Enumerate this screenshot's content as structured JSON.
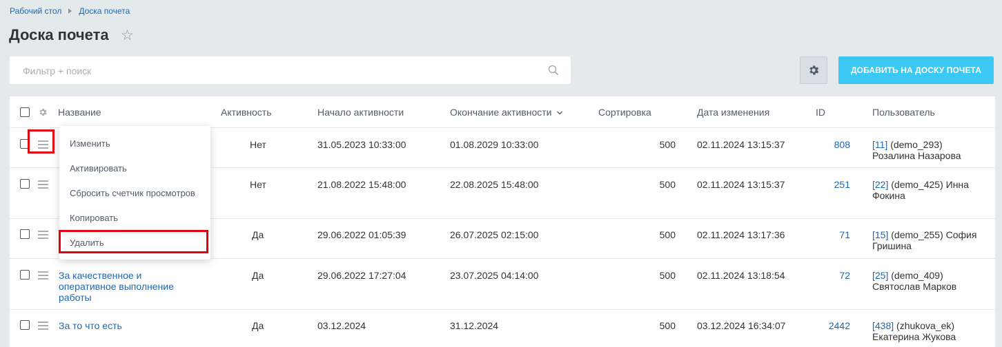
{
  "breadcrumb": [
    "Рабочий стол",
    "Доска почета"
  ],
  "page_title": "Доска почета",
  "filter": {
    "placeholder": "Фильтр + поиск"
  },
  "add_button": "ДОБАВИТЬ НА ДОСКУ ПОЧЕТА",
  "columns": {
    "name": "Название",
    "active": "Активность",
    "start": "Начало активности",
    "end": "Окончание активности",
    "sort": "Сортировка",
    "modified": "Дата изменения",
    "id": "ID",
    "user": "Пользователь"
  },
  "rows": [
    {
      "name": "",
      "active": "Нет",
      "start": "31.05.2023 10:33:00",
      "end": "01.08.2029 10:33:00",
      "sort": "500",
      "modified": "02.11.2024 13:15:37",
      "id": "808",
      "user_id": "[11]",
      "user_rest": " (demo_293)",
      "user_line2": "Розалина Назарова"
    },
    {
      "name": "",
      "active": "Нет",
      "start": "21.08.2022 15:48:00",
      "end": "22.08.2025 15:48:00",
      "sort": "500",
      "modified": "02.11.2024 13:15:37",
      "id": "251",
      "user_id": "[22]",
      "user_rest": " (demo_425) Инна",
      "user_line2": "Фокина"
    },
    {
      "name": "",
      "active": "Да",
      "start": "29.06.2022 01:05:39",
      "end": "26.07.2025 02:15:00",
      "sort": "500",
      "modified": "02.11.2024 13:17:36",
      "id": "71",
      "user_id": "[15]",
      "user_rest": " (demo_255) София",
      "user_line2": "Гришина"
    },
    {
      "name_lines": [
        "За качественное и",
        "оперативное выполнение",
        "работы"
      ],
      "active": "Да",
      "start": "29.06.2022 17:27:04",
      "end": "23.07.2025 04:14:00",
      "sort": "500",
      "modified": "02.11.2024 13:18:54",
      "id": "72",
      "user_id": "[25]",
      "user_rest": " (demo_409)",
      "user_line2": "Святослав Марков"
    },
    {
      "name_lines": [
        "За то что есть"
      ],
      "active": "Да",
      "start": "03.12.2024",
      "end": "31.12.2024",
      "sort": "500",
      "modified": "03.12.2024 16:34:07",
      "id": "2442",
      "user_id": "[438]",
      "user_rest": " (zhukova_ek)",
      "user_line2": "Екатерина Жукова"
    }
  ],
  "context_menu": [
    "Изменить",
    "Активировать",
    "Сбросить счетчик просмотров",
    "Копировать",
    "Удалить"
  ],
  "highlight_color": "#e3000f",
  "accent_color": "#3bc8f5"
}
